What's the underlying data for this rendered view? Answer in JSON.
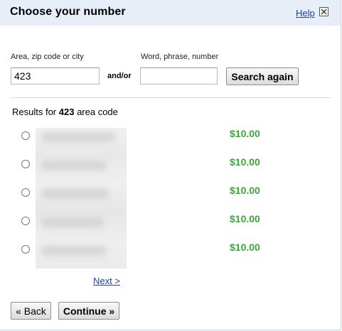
{
  "dialog": {
    "title": "Choose your number",
    "help_label": "Help"
  },
  "search": {
    "area_label": "Area, zip code or city",
    "area_value": "423",
    "andor_label": "and/or",
    "word_label": "Word, phrase, number",
    "word_value": "",
    "search_button": "Search again"
  },
  "results": {
    "prefix": "Results for ",
    "query": "423",
    "suffix": " area code",
    "items": [
      {
        "price": "$10.00"
      },
      {
        "price": "$10.00"
      },
      {
        "price": "$10.00"
      },
      {
        "price": "$10.00"
      },
      {
        "price": "$10.00"
      }
    ]
  },
  "pagination": {
    "next_label": "Next >"
  },
  "footer": {
    "back_label": "« Back",
    "continue_label": "Continue »"
  },
  "colors": {
    "title_bar": "#e8eef7",
    "link": "#1a3fb0",
    "price": "#3aa63a"
  }
}
